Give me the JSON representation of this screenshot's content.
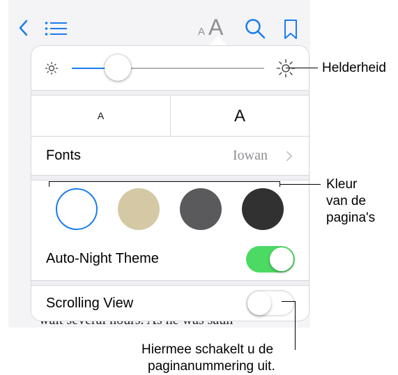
{
  "reading_text": "wait several hours. As he was saun-",
  "toolbar": {
    "back_icon": "chevron-left-icon",
    "toc_icon": "list-icon",
    "appearance_small": "A",
    "appearance_large": "A",
    "search_icon": "search-icon",
    "bookmark_icon": "bookmark-icon"
  },
  "popover": {
    "brightness": {
      "level_percent": 21,
      "min_icon": "sun-small-icon",
      "max_icon": "sun-large-icon"
    },
    "text_size": {
      "smaller_label": "A",
      "larger_label": "A"
    },
    "fonts": {
      "label": "Fonts",
      "value": "Iowan"
    },
    "page_colors": [
      "#ffffff",
      "#d4c9a4",
      "#5a5a5c",
      "#313132"
    ],
    "selected_color_index": 0,
    "auto_night": {
      "label": "Auto-Night Theme",
      "on": true
    },
    "scrolling_view": {
      "label": "Scrolling View",
      "on": false
    }
  },
  "callouts": {
    "brightness": "Helderheid",
    "page_color_line1": "Kleur",
    "page_color_line2": "van de",
    "page_color_line3": "pagina's",
    "scrolling_line1": "Hiermee schakelt u de",
    "scrolling_line2": "paginanummering uit."
  },
  "colors": {
    "accent": "#1a7cf0",
    "toggle_on": "#4cd964",
    "icon_gray": "#8e8e93"
  }
}
